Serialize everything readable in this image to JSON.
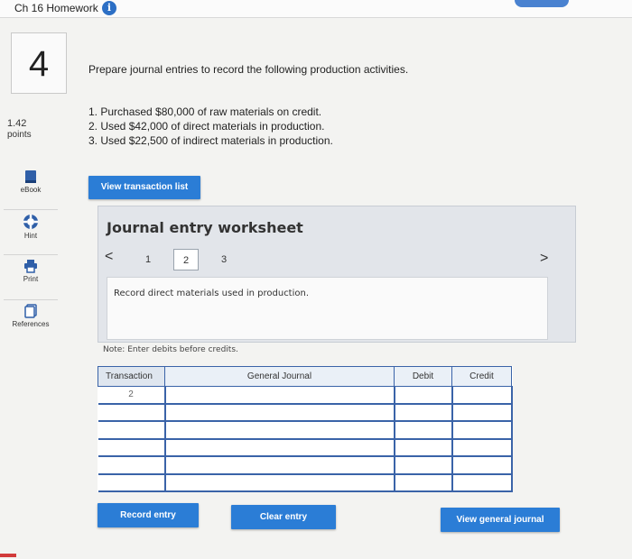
{
  "header": {
    "title": "Ch 16 Homework",
    "info_icon": "i"
  },
  "question": {
    "number": "4",
    "points_value": "1.42",
    "points_label": "points",
    "prompt": "Prepare journal entries to record the following production activities.",
    "steps": [
      "1. Purchased $80,000 of raw materials on credit.",
      "2. Used $42,000 of direct materials in production.",
      "3. Used $22,500 of indirect materials in production."
    ]
  },
  "tools": [
    {
      "icon": "ebook-icon",
      "label": "eBook"
    },
    {
      "icon": "hint-icon",
      "label": "Hint"
    },
    {
      "icon": "print-icon",
      "label": "Print"
    },
    {
      "icon": "references-icon",
      "label": "References"
    }
  ],
  "buttons": {
    "view_transaction_list": "View transaction list",
    "record_entry": "Record entry",
    "clear_entry": "Clear entry",
    "view_general_journal": "View general journal"
  },
  "worksheet": {
    "title": "Journal entry worksheet",
    "pages": [
      "1",
      "2",
      "3"
    ],
    "active_page": "2",
    "prev_arrow": "<",
    "next_arrow": ">",
    "instruction": "Record direct materials used in production.",
    "note": "Note: Enter debits before credits."
  },
  "journal_table": {
    "headers": [
      "Transaction",
      "General Journal",
      "Debit",
      "Credit"
    ],
    "rows": [
      {
        "transaction": "2",
        "account": "",
        "debit": "",
        "credit": ""
      },
      {
        "transaction": "",
        "account": "",
        "debit": "",
        "credit": ""
      },
      {
        "transaction": "",
        "account": "",
        "debit": "",
        "credit": ""
      },
      {
        "transaction": "",
        "account": "",
        "debit": "",
        "credit": ""
      },
      {
        "transaction": "",
        "account": "",
        "debit": "",
        "credit": ""
      },
      {
        "transaction": "",
        "account": "",
        "debit": "",
        "credit": ""
      }
    ]
  },
  "colors": {
    "accent_blue": "#2b7dd6",
    "table_border": "#3a63a8",
    "panel_bg": "#e2e5ea"
  }
}
